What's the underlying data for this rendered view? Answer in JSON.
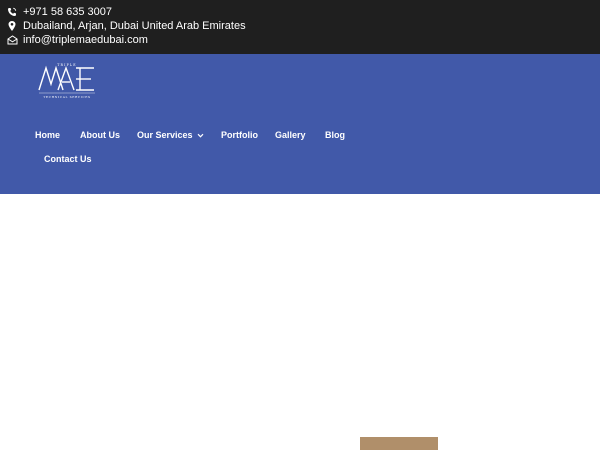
{
  "contact": {
    "phone": "+971 58 635 3007",
    "address": "Dubailand, Arjan, Dubai United Arab Emirates",
    "email": "info@triplemaedubai.com"
  },
  "logo": {
    "top_text": "TRIPLE",
    "letters": "MAE",
    "bottom_text": "TECHNICAL SERVICES"
  },
  "nav": {
    "items": [
      "Home",
      "About Us",
      "Our Services",
      "Portfolio",
      "Gallery",
      "Blog",
      "Contact Us"
    ]
  },
  "colors": {
    "topbar": "#1f1f1f",
    "nav_background": "#4159a9",
    "accent": "#b08f6a"
  },
  "icons": [
    "phone-icon",
    "location-pin-icon",
    "envelope-icon",
    "chevron-down-icon"
  ]
}
